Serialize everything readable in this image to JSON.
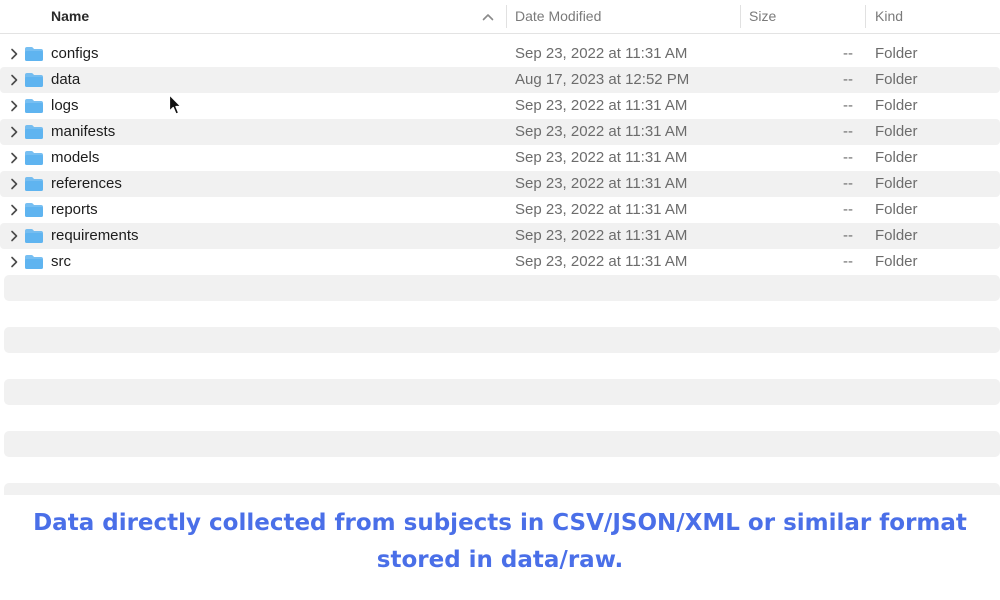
{
  "columns": {
    "name": "Name",
    "date_modified": "Date Modified",
    "size": "Size",
    "kind": "Kind"
  },
  "files": [
    {
      "name": "configs",
      "date": "Sep 23, 2022 at 11:31 AM",
      "size": "--",
      "kind": "Folder"
    },
    {
      "name": "data",
      "date": "Aug 17, 2023 at 12:52 PM",
      "size": "--",
      "kind": "Folder"
    },
    {
      "name": "logs",
      "date": "Sep 23, 2022 at 11:31 AM",
      "size": "--",
      "kind": "Folder"
    },
    {
      "name": "manifests",
      "date": "Sep 23, 2022 at 11:31 AM",
      "size": "--",
      "kind": "Folder"
    },
    {
      "name": "models",
      "date": "Sep 23, 2022 at 11:31 AM",
      "size": "--",
      "kind": "Folder"
    },
    {
      "name": "references",
      "date": "Sep 23, 2022 at 11:31 AM",
      "size": "--",
      "kind": "Folder"
    },
    {
      "name": "reports",
      "date": "Sep 23, 2022 at 11:31 AM",
      "size": "--",
      "kind": "Folder"
    },
    {
      "name": "requirements",
      "date": "Sep 23, 2022 at 11:31 AM",
      "size": "--",
      "kind": "Folder"
    },
    {
      "name": "src",
      "date": "Sep 23, 2022 at 11:31 AM",
      "size": "--",
      "kind": "Folder"
    }
  ],
  "caption": {
    "line1": "Data directly collected from subjects in CSV/JSON/XML or similar format",
    "line2": "stored in data/raw."
  },
  "icons": {
    "sort": "chevron-up-icon",
    "disclosure": "chevron-right-icon",
    "folder": "folder-icon",
    "pointer": "cursor-icon"
  },
  "colors": {
    "folder": "#5fb4f0",
    "caption": "#4a6fe8",
    "row_stripe": "#f1f1f1"
  }
}
